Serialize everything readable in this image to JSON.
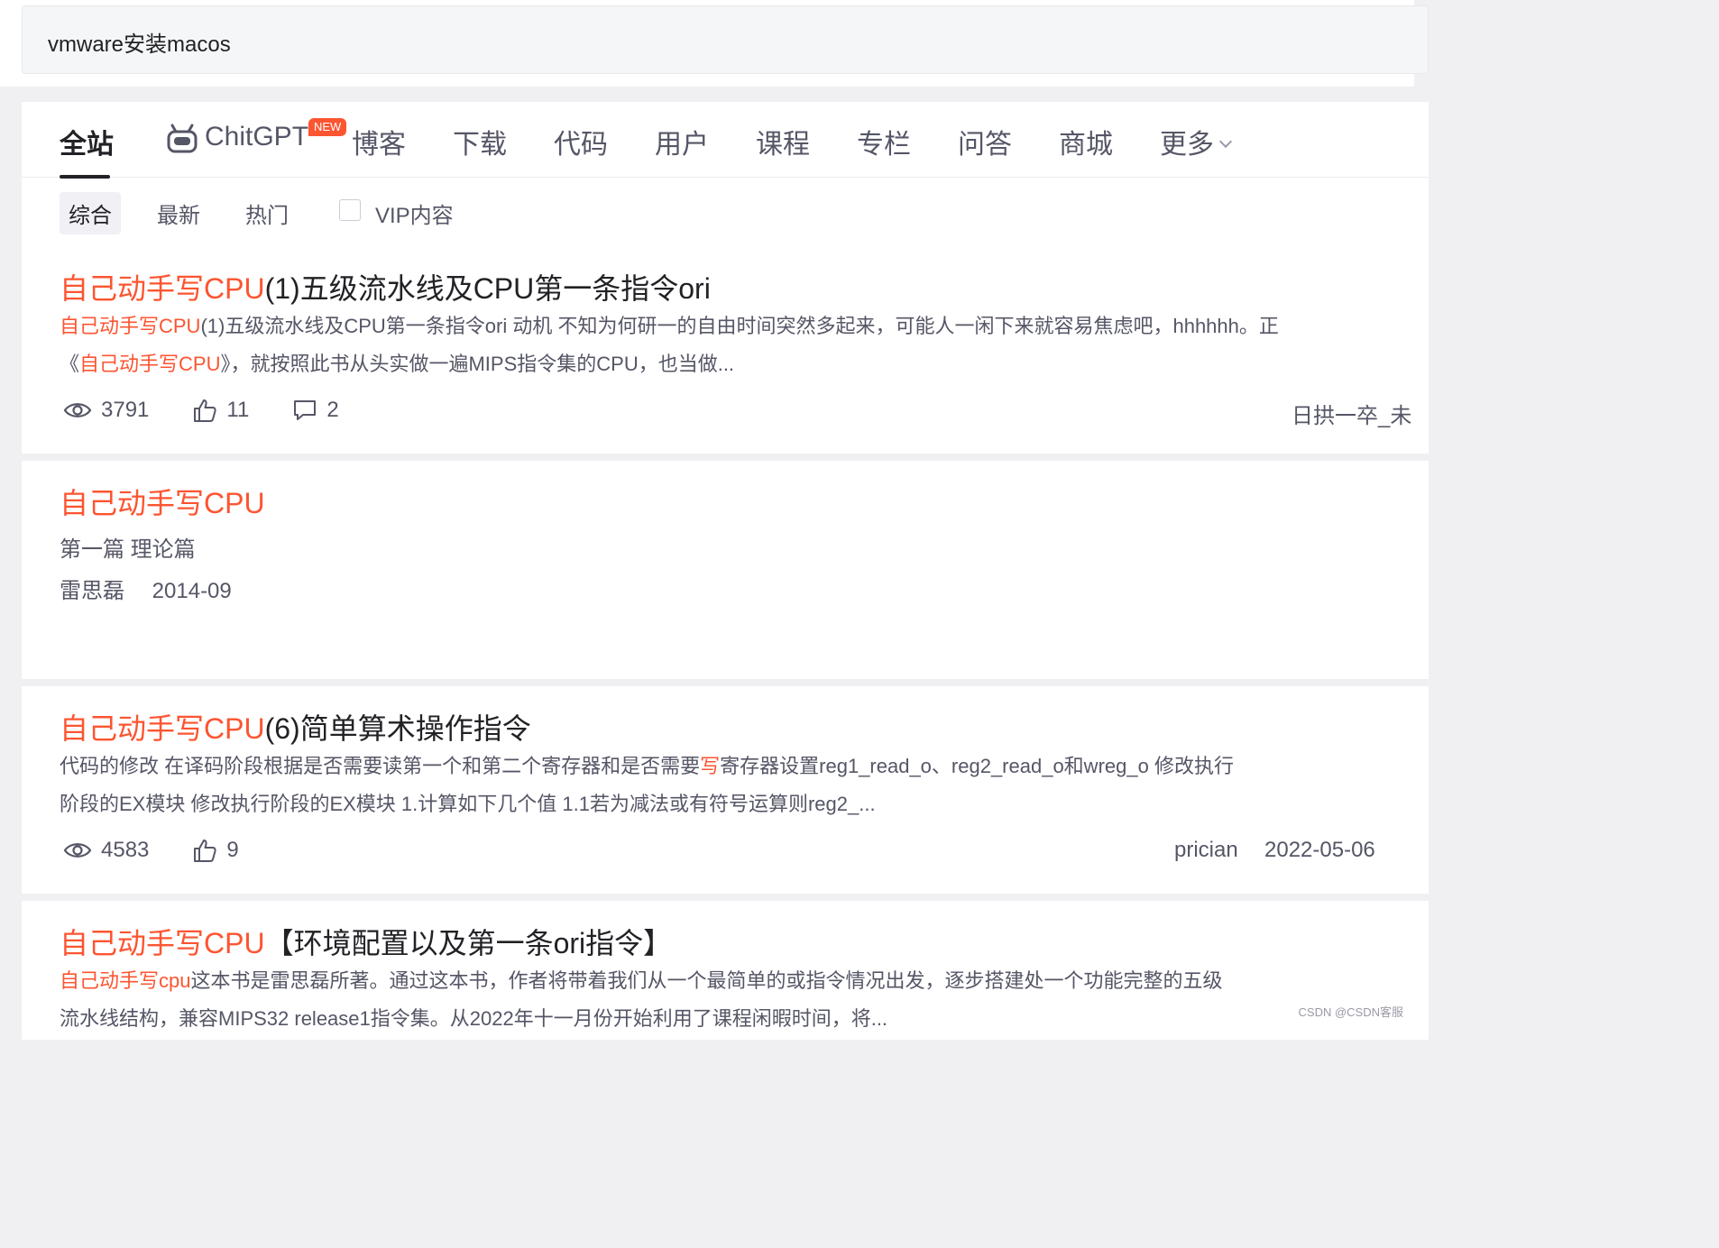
{
  "search": {
    "query": "vmware安装macos"
  },
  "tabs": [
    {
      "label": "全站"
    },
    {
      "label": "ChitGPT"
    },
    {
      "label": "博客"
    },
    {
      "label": "下载"
    },
    {
      "label": "代码"
    },
    {
      "label": "用户"
    },
    {
      "label": "课程"
    },
    {
      "label": "专栏"
    },
    {
      "label": "问答"
    },
    {
      "label": "商城"
    },
    {
      "label": "更多"
    }
  ],
  "new_badge": "NEW",
  "filters": [
    {
      "label": "综合"
    },
    {
      "label": "最新"
    },
    {
      "label": "热门"
    }
  ],
  "vip_filter": {
    "label": "VIP内容",
    "checked": false
  },
  "results": [
    {
      "title_hl": "自己动手写CPU",
      "title_rest": "(1)五级流水线及CPU第一条指令ori",
      "desc1_hl": "自己动手写CPU",
      "desc1_rest": "(1)五级流水线及CPU第一条指令ori 动机 不知为何研一的自由时间突然多起来，可能人一闲下来就容易焦虑吧，hhhhhh。正",
      "desc2_a": "《",
      "desc2_hl": "自己动手写CPU",
      "desc2_rest": "》，就按照此书从头实做一遍MIPS指令集的CPU，也当做...",
      "views": "3791",
      "likes": "11",
      "comments": "2",
      "author": "日拱一卒_未"
    },
    {
      "title_hl": "自己动手写CPU",
      "subtitle": "第一篇 理论篇",
      "author": "雷思磊",
      "date": "2014-09"
    },
    {
      "title_hl": "自己动手写CPU",
      "title_rest": "(6)简单算术操作指令",
      "desc1_a": "代码的修改 在译码阶段根据是否需要读第一个和第二个寄存器和是否需要",
      "desc1_hl": "写",
      "desc1_rest": "寄存器设置reg1_read_o、reg2_read_o和wreg_o 修改执行",
      "desc2": "阶段的EX模块 修改执行阶段的EX模块 1.计算如下几个值 1.1若为减法或有符号运算则reg2_...",
      "views": "4583",
      "likes": "9",
      "author": "prician",
      "date": "2022-05-06"
    },
    {
      "title_hl": "自己动手写CPU",
      "title_rest": "【环境配置以及第一条ori指令】",
      "desc1_hl": "自己动手写cpu",
      "desc1_rest": "这本书是雷思磊所著。通过这本书，作者将带着我们从一个最简单的或指令情况出发，逐步搭建处一个功能完整的五级",
      "desc2": "流水线结构，兼容MIPS32 release1指令集。从2022年十一月份开始利用了课程闲暇时间，将..."
    }
  ],
  "watermark": "CSDN @CSDN客服",
  "colors": {
    "highlight": "#fc5531",
    "text": "#222226",
    "muted": "#555666"
  }
}
